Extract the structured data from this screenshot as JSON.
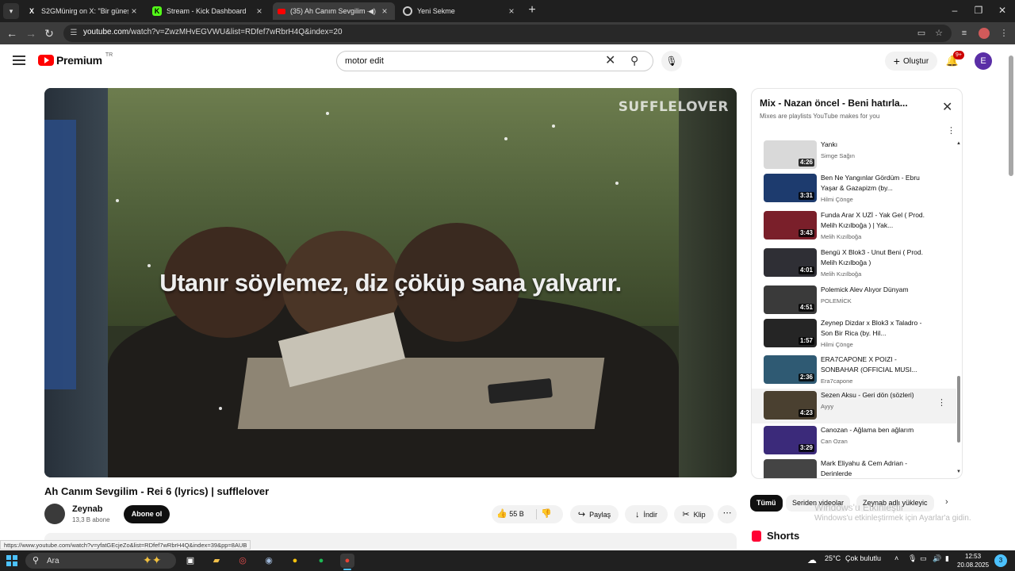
{
  "browser": {
    "tabs": [
      {
        "title": "S2GMünirg on X: \"Bir güneş pa",
        "favicon": "x-icon"
      },
      {
        "title": "Stream - Kick Dashboard",
        "favicon": "kick-icon"
      },
      {
        "title": "(35) Ah Canım Sevgilim - Re",
        "favicon": "youtube-icon",
        "active": true
      },
      {
        "title": "Yeni Sekme",
        "favicon": "chrome-icon"
      }
    ],
    "url_host": "youtube.com",
    "url_path": "/watch?v=ZwzMHvEGVWU&list=RDfef7wRbrH4Q&index=20"
  },
  "header": {
    "logo_text": "Premium",
    "country": "TR",
    "search_value": "motor edit",
    "create_label": "Oluştur",
    "notification_count": "9+",
    "avatar_letter": "E"
  },
  "player": {
    "watermark": "SUFFLELOVER",
    "lyric": "Utanır söylemez, diz çöküp sana yalvarır."
  },
  "video": {
    "title": "Ah Canım Sevgilim - Rei 6 (lyrics) | sufflelover",
    "channel": "Zeynab",
    "subscribers": "13,3 B abone",
    "subscribe_label": "Abone ol",
    "likes": "55 B",
    "share_label": "Paylaş",
    "download_label": "İndir",
    "clip_label": "Klip"
  },
  "status_bar": "https://www.youtube.com/watch?v=yfatGEcjeZo&list=RDfef7wRbrH4Q&index=39&pp=8AUB",
  "playlist": {
    "title": "Mix - Nazan öncel - Beni hatırla...",
    "subtitle": "Mixes are playlists YouTube makes for you",
    "items": [
      {
        "title": "Yankı",
        "channel": "Simge Sağın",
        "duration": "4:26",
        "color": "#d9d9d9"
      },
      {
        "title": "Ben Ne Yangınlar Gördüm - Ebru Yaşar & Gazapizm (by...",
        "channel": "Hilmi Çönge",
        "duration": "3:31",
        "color": "#1d3b6e"
      },
      {
        "title": "Funda Arar X UZİ - Yak Gel ( Prod. Melih Kızılboğa ) | Yak...",
        "channel": "Melih Kızılboğa",
        "duration": "3:43",
        "color": "#7a1f2a"
      },
      {
        "title": "Bengü X Blok3 - Unut Beni ( Prod. Melih Kızılboğa )",
        "channel": "Melih Kızılboğa",
        "duration": "4:01",
        "color": "#2f2f35"
      },
      {
        "title": "Polemick Alev Alıyor Dünyam",
        "channel": "POLEMİCK",
        "duration": "4:51",
        "color": "#3a3a3a"
      },
      {
        "title": "Zeynep Dizdar x Blok3 x Taladro - Son Bir Rica (by. Hil...",
        "channel": "Hilmi Çönge",
        "duration": "1:57",
        "color": "#252525"
      },
      {
        "title": "ERA7CAPONE X POIZI - SONBAHAR (OFFICIAL MUSI...",
        "channel": "Era7capone",
        "duration": "2:36",
        "color": "#2f5a73"
      },
      {
        "title": "Sezen Aksu - Geri dön (sözleri)",
        "channel": "Ayyy",
        "duration": "4:23",
        "color": "#4a4030"
      },
      {
        "title": "Canozan - Ağlama ben ağlarım",
        "channel": "Can Ozan",
        "duration": "3:29",
        "color": "#3b2a7a"
      },
      {
        "title": "Mark Eliyahu & Cem Adrian - Derinlerde",
        "channel": "",
        "duration": "",
        "color": "#444444"
      }
    ]
  },
  "chips": [
    "Tümü",
    "Seriden videolar",
    "Zeynab adlı yükleyic"
  ],
  "windows_watermark": {
    "line1": "Windows'u Etkinleştir",
    "line2": "Windows'u etkinleştirmek için Ayarlar'a gidin."
  },
  "shorts_label": "Shorts",
  "taskbar": {
    "search_placeholder": "Ara",
    "temperature": "25°C",
    "weather": "Çok bulutlu",
    "time": "12:53",
    "date": "20.08.2025",
    "notifications": "3"
  }
}
